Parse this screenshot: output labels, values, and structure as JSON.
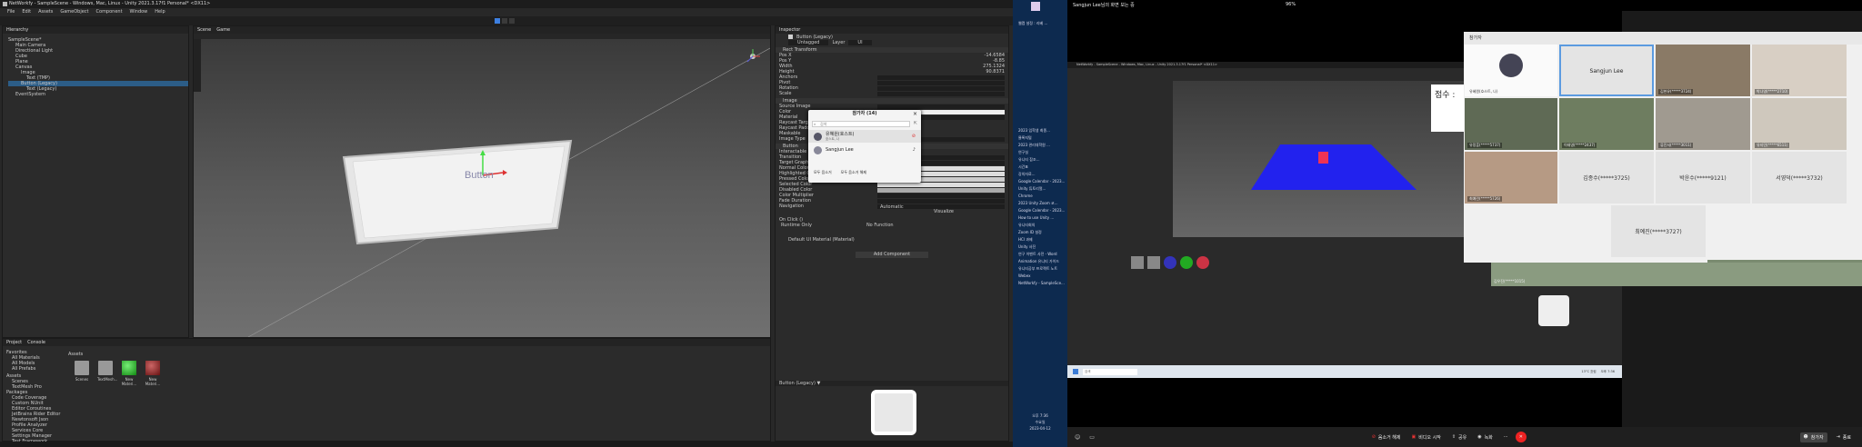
{
  "unity": {
    "title": "NetWorkfy - SampleScene - Windows, Mac, Linux - Unity 2021.3.17f1 Personal* <DX11>",
    "menu": [
      "File",
      "Edit",
      "Assets",
      "GameObject",
      "Component",
      "Window",
      "Help"
    ],
    "hierarchy": {
      "tab": "Hierarchy",
      "items": [
        "SampleScene*",
        "Main Camera",
        "Directional Light",
        "Cube",
        "Plane",
        "Canvas",
        "Image",
        "Text (TMP)",
        "Button (Legacy)",
        "Text (Legacy)",
        "EventSystem"
      ]
    },
    "scene_tabs": [
      "Scene",
      "Game"
    ],
    "button_text": "Button",
    "inspector": {
      "tab": "Inspector",
      "object_name": "Button (Legacy)",
      "tag_value": "Untagged",
      "layer_label": "Layer",
      "layer_value": "UI",
      "sections": [
        "Rect Transform",
        "Image",
        "Button"
      ],
      "rows": [
        "Pos X",
        "Pos Y",
        "Width",
        "Height",
        "Anchors",
        "Pivot",
        "Rotation",
        "Scale",
        "Source Image",
        "Color",
        "Material",
        "Raycast Target",
        "Raycast Padding",
        "Maskable",
        "Image Type",
        "Interactable",
        "Transition",
        "Target Graphic",
        "Normal Color",
        "Highlighted Color",
        "Pressed Color",
        "Selected Color",
        "Disabled Color",
        "Color Multiplier",
        "Fade Duration",
        "Navigation"
      ],
      "values": [
        "-14.6584",
        "-8.85",
        "275.1324",
        "90.8371"
      ],
      "transition_value": "Color Tint",
      "navigation_value": "Automatic",
      "visualize": "Visualize",
      "onclick": "On Click ()",
      "runtime_only": "Runtime Only",
      "no_function": "No Function",
      "default_material": "Default UI Material (Material)",
      "add_component": "Add Component",
      "preview_label": "Button (Legacy) ▼"
    },
    "project": {
      "tabs": [
        "Project",
        "Console"
      ],
      "favorites": [
        "Favorites",
        "All Materials",
        "All Models",
        "All Prefabs"
      ],
      "assets_tree": [
        "Assets",
        "Scenes",
        "TextMesh Pro",
        "Packages",
        "Code Coverage",
        "Custom NUnit",
        "Editor Coroutines",
        "JetBrains Rider Editor",
        "Newtonsoft Json",
        "Profile Analyzer",
        "Services Core",
        "Settings Manager",
        "Test Framework"
      ],
      "breadcrumb": "Assets",
      "assets": [
        "Scenes",
        "TextMesh...",
        "New Materi...",
        "New Materi..."
      ]
    }
  },
  "dialog": {
    "title": "참가자 (14)",
    "search_placeholder": "검색",
    "participants": [
      {
        "name": "유혜원(호스트)",
        "sub": "호스트, 나"
      },
      {
        "name": "Sangjun Lee",
        "sub": ""
      }
    ],
    "mute_all": "모두 음소거",
    "unmute_all": "모두 음소거 해제"
  },
  "midbar": {
    "items": [
      "웹캠 설정 : 리베 ...",
      "2023 입학생 최종...",
      "뮬록지털",
      "2023 관리대학원 ...",
      "연구실",
      "유니티 참조...",
      "시간표",
      "강의자료...",
      "Google Calendar - 2023...",
      "Unity 튜토리얼...",
      "Chrome",
      "2023 Unity Zoom 코...",
      "Google Calendar - 2023...",
      "How to use Unity ...",
      "유니티회의",
      "Zoom ID 설정",
      "HCI 과제",
      "Unity 사진",
      "연구 이벤트 사전 - Word",
      "Animation 유니티 가이드",
      "유니티공부 프로젝트 노트",
      "Webex",
      "NetWorkfy - SampleSce..."
    ],
    "time": "오후 7:36",
    "day": "수요일",
    "date": "2023-04-12"
  },
  "zoom": {
    "title": "Sangjun Lee님의 화면 보는 중",
    "zoom_level": "96%",
    "share_title": "NetWorkfy - SampleScene - Windows, Mac, Linux - Unity 2021.3.17f1 Personal* <DX11>",
    "score_label": "점수 :",
    "participants_header": "참가자",
    "tiles": [
      {
        "name": "유혜원(호스트, 나)",
        "type": "avatar"
      },
      {
        "name": "Sangjun Lee",
        "type": "gray"
      },
      {
        "name": "김현유(*****3724)",
        "type": "video"
      },
      {
        "name": "박나영(*****2710)",
        "type": "video"
      },
      {
        "name": "유정훈(*****5737)",
        "type": "video"
      },
      {
        "name": "이태영(*****2437)",
        "type": "video"
      },
      {
        "name": "류진서(*****3011)",
        "type": "video"
      },
      {
        "name": "유지민(*****6511)",
        "type": "video"
      },
      {
        "name": "최예린(*****5726)",
        "type": "video"
      },
      {
        "name": "김종수(*****3725)",
        "type": "gray"
      },
      {
        "name": "박윤수(*****9121)",
        "type": "gray"
      },
      {
        "name": "서영덕(*****3732)",
        "type": "gray"
      },
      {
        "name": "최예진(*****3727)",
        "type": "gray"
      },
      {
        "name": "김우진(*****1015)",
        "type": "video"
      }
    ],
    "toolbar": {
      "mute": "음소거 해제",
      "video": "비디오 시작",
      "share": "공유",
      "record": "녹화",
      "participants": "참가자",
      "leave": "종료"
    },
    "taskbar_time": "오후 7:36",
    "taskbar_date": "2023-04-12",
    "taskbar_search": "검색",
    "weather": "13°C 흐림"
  }
}
